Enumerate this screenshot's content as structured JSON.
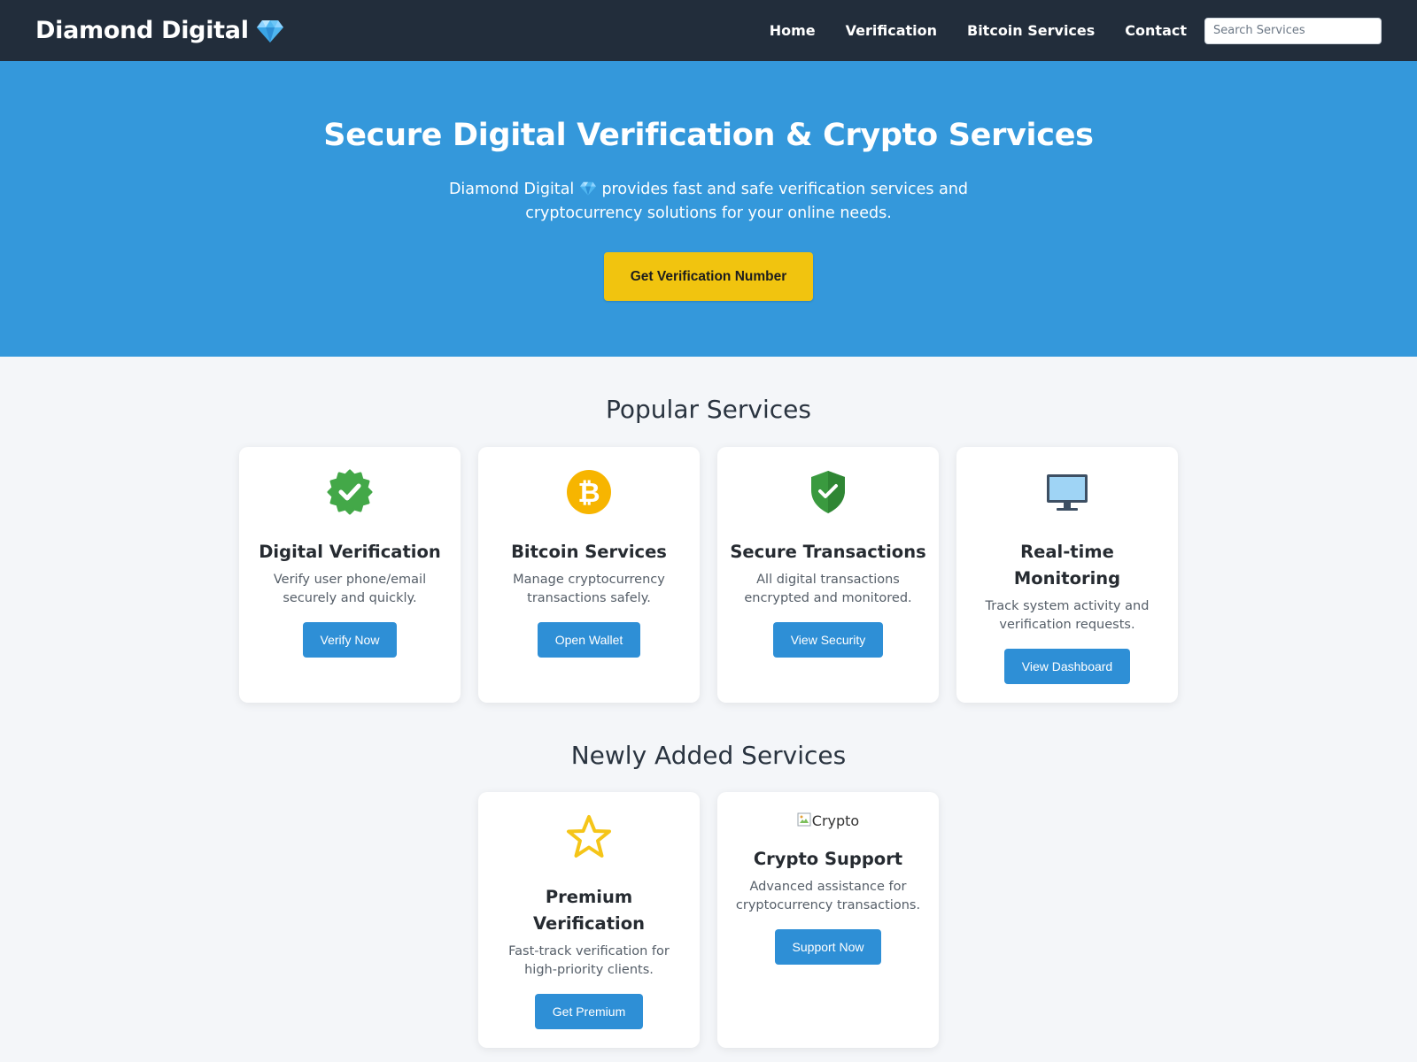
{
  "nav": {
    "brand": "Diamond Digital",
    "links": [
      "Home",
      "Verification",
      "Bitcoin Services",
      "Contact"
    ],
    "search_placeholder": "Search Services"
  },
  "hero": {
    "title": "Secure Digital Verification & Crypto Services",
    "subtitle_pre": "Diamond Digital",
    "subtitle_post": "provides fast and safe verification services and cryptocurrency solutions for your online needs.",
    "cta": "Get Verification Number"
  },
  "popular": {
    "title": "Popular Services",
    "cards": [
      {
        "icon": "verified-badge-icon",
        "title": "Digital Verification",
        "desc": "Verify user phone/email securely and quickly.",
        "button": "Verify Now"
      },
      {
        "icon": "bitcoin-icon",
        "title": "Bitcoin Services",
        "desc": "Manage cryptocurrency transactions safely.",
        "button": "Open Wallet"
      },
      {
        "icon": "shield-check-icon",
        "title": "Secure Transactions",
        "desc": "All digital transactions encrypted and monitored.",
        "button": "View Security"
      },
      {
        "icon": "monitor-icon",
        "title": "Real-time Monitoring",
        "desc": "Track system activity and verification requests.",
        "button": "View Dashboard"
      }
    ]
  },
  "newly": {
    "title": "Newly Added Services",
    "cards": [
      {
        "icon": "star-icon",
        "title": "Premium Verification",
        "desc": "Fast-track verification for high-priority clients.",
        "button": "Get Premium"
      },
      {
        "icon": "broken-image-icon",
        "image_alt": "Crypto",
        "title": "Crypto Support",
        "desc": "Advanced assistance for cryptocurrency transactions.",
        "button": "Support Now"
      }
    ]
  },
  "colors": {
    "navbar": "#222d3b",
    "hero": "#3498db",
    "cta": "#f1c40f",
    "button": "#2e8fd6",
    "background": "#f4f6f9"
  }
}
